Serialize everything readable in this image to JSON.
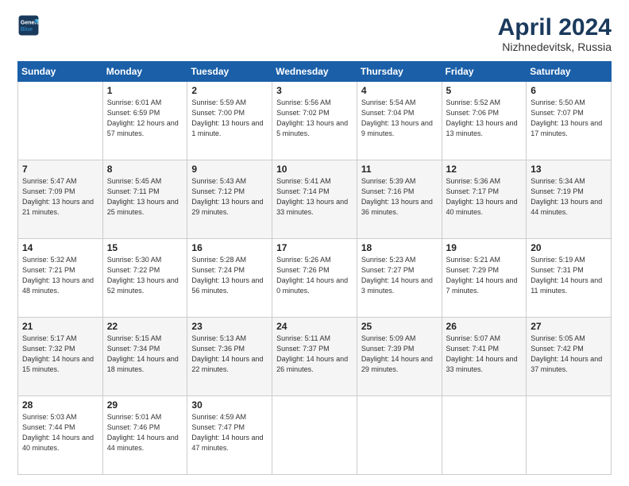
{
  "header": {
    "logo_line1": "General",
    "logo_line2": "Blue",
    "month": "April 2024",
    "location": "Nizhnedevitsk, Russia"
  },
  "days_of_week": [
    "Sunday",
    "Monday",
    "Tuesday",
    "Wednesday",
    "Thursday",
    "Friday",
    "Saturday"
  ],
  "weeks": [
    [
      {
        "day": "",
        "text": ""
      },
      {
        "day": "1",
        "text": "Sunrise: 6:01 AM\nSunset: 6:59 PM\nDaylight: 12 hours\nand 57 minutes."
      },
      {
        "day": "2",
        "text": "Sunrise: 5:59 AM\nSunset: 7:00 PM\nDaylight: 13 hours\nand 1 minute."
      },
      {
        "day": "3",
        "text": "Sunrise: 5:56 AM\nSunset: 7:02 PM\nDaylight: 13 hours\nand 5 minutes."
      },
      {
        "day": "4",
        "text": "Sunrise: 5:54 AM\nSunset: 7:04 PM\nDaylight: 13 hours\nand 9 minutes."
      },
      {
        "day": "5",
        "text": "Sunrise: 5:52 AM\nSunset: 7:06 PM\nDaylight: 13 hours\nand 13 minutes."
      },
      {
        "day": "6",
        "text": "Sunrise: 5:50 AM\nSunset: 7:07 PM\nDaylight: 13 hours\nand 17 minutes."
      }
    ],
    [
      {
        "day": "7",
        "text": "Sunrise: 5:47 AM\nSunset: 7:09 PM\nDaylight: 13 hours\nand 21 minutes."
      },
      {
        "day": "8",
        "text": "Sunrise: 5:45 AM\nSunset: 7:11 PM\nDaylight: 13 hours\nand 25 minutes."
      },
      {
        "day": "9",
        "text": "Sunrise: 5:43 AM\nSunset: 7:12 PM\nDaylight: 13 hours\nand 29 minutes."
      },
      {
        "day": "10",
        "text": "Sunrise: 5:41 AM\nSunset: 7:14 PM\nDaylight: 13 hours\nand 33 minutes."
      },
      {
        "day": "11",
        "text": "Sunrise: 5:39 AM\nSunset: 7:16 PM\nDaylight: 13 hours\nand 36 minutes."
      },
      {
        "day": "12",
        "text": "Sunrise: 5:36 AM\nSunset: 7:17 PM\nDaylight: 13 hours\nand 40 minutes."
      },
      {
        "day": "13",
        "text": "Sunrise: 5:34 AM\nSunset: 7:19 PM\nDaylight: 13 hours\nand 44 minutes."
      }
    ],
    [
      {
        "day": "14",
        "text": "Sunrise: 5:32 AM\nSunset: 7:21 PM\nDaylight: 13 hours\nand 48 minutes."
      },
      {
        "day": "15",
        "text": "Sunrise: 5:30 AM\nSunset: 7:22 PM\nDaylight: 13 hours\nand 52 minutes."
      },
      {
        "day": "16",
        "text": "Sunrise: 5:28 AM\nSunset: 7:24 PM\nDaylight: 13 hours\nand 56 minutes."
      },
      {
        "day": "17",
        "text": "Sunrise: 5:26 AM\nSunset: 7:26 PM\nDaylight: 14 hours\nand 0 minutes."
      },
      {
        "day": "18",
        "text": "Sunrise: 5:23 AM\nSunset: 7:27 PM\nDaylight: 14 hours\nand 3 minutes."
      },
      {
        "day": "19",
        "text": "Sunrise: 5:21 AM\nSunset: 7:29 PM\nDaylight: 14 hours\nand 7 minutes."
      },
      {
        "day": "20",
        "text": "Sunrise: 5:19 AM\nSunset: 7:31 PM\nDaylight: 14 hours\nand 11 minutes."
      }
    ],
    [
      {
        "day": "21",
        "text": "Sunrise: 5:17 AM\nSunset: 7:32 PM\nDaylight: 14 hours\nand 15 minutes."
      },
      {
        "day": "22",
        "text": "Sunrise: 5:15 AM\nSunset: 7:34 PM\nDaylight: 14 hours\nand 18 minutes."
      },
      {
        "day": "23",
        "text": "Sunrise: 5:13 AM\nSunset: 7:36 PM\nDaylight: 14 hours\nand 22 minutes."
      },
      {
        "day": "24",
        "text": "Sunrise: 5:11 AM\nSunset: 7:37 PM\nDaylight: 14 hours\nand 26 minutes."
      },
      {
        "day": "25",
        "text": "Sunrise: 5:09 AM\nSunset: 7:39 PM\nDaylight: 14 hours\nand 29 minutes."
      },
      {
        "day": "26",
        "text": "Sunrise: 5:07 AM\nSunset: 7:41 PM\nDaylight: 14 hours\nand 33 minutes."
      },
      {
        "day": "27",
        "text": "Sunrise: 5:05 AM\nSunset: 7:42 PM\nDaylight: 14 hours\nand 37 minutes."
      }
    ],
    [
      {
        "day": "28",
        "text": "Sunrise: 5:03 AM\nSunset: 7:44 PM\nDaylight: 14 hours\nand 40 minutes."
      },
      {
        "day": "29",
        "text": "Sunrise: 5:01 AM\nSunset: 7:46 PM\nDaylight: 14 hours\nand 44 minutes."
      },
      {
        "day": "30",
        "text": "Sunrise: 4:59 AM\nSunset: 7:47 PM\nDaylight: 14 hours\nand 47 minutes."
      },
      {
        "day": "",
        "text": ""
      },
      {
        "day": "",
        "text": ""
      },
      {
        "day": "",
        "text": ""
      },
      {
        "day": "",
        "text": ""
      }
    ]
  ]
}
